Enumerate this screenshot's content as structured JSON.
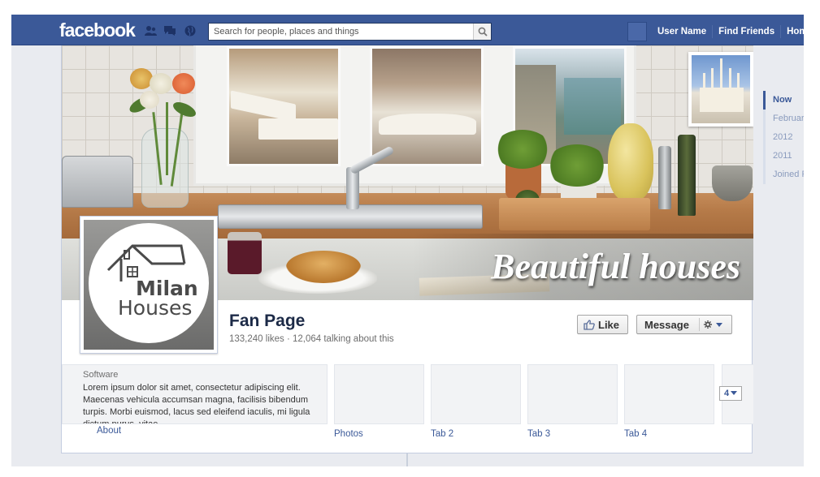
{
  "topbar": {
    "logo": "facebook",
    "search_placeholder": "Search for people, places and things",
    "links": [
      "User Name",
      "Find Friends",
      "Home"
    ]
  },
  "cover": {
    "title": "Beautiful houses"
  },
  "profile": {
    "logo_line1": "Milan",
    "logo_line2": "Houses"
  },
  "page": {
    "name": "Fan Page",
    "stats": "133,240 likes · 12,064 talking about this"
  },
  "actions": {
    "like": "Like",
    "message": "Message"
  },
  "about": {
    "category": "Software",
    "text": "Lorem ipsum dolor sit amet, consectetur adipiscing elit. Maecenas vehicula accumsan magna, facilisis bibendum turpis. Morbi euismod, lacus sed eleifend iaculis, mi ligula dictum purus, vitae",
    "link": "About"
  },
  "tabs": [
    {
      "label": "Photos"
    },
    {
      "label": "Tab 2"
    },
    {
      "label": "Tab 3"
    },
    {
      "label": "Tab 4"
    }
  ],
  "more_tabs": {
    "count": "4"
  },
  "scrubber": [
    "Now",
    "February",
    "2012",
    "2011",
    "Joined Facebook"
  ],
  "colors": {
    "brand": "#3b5998",
    "link": "#3b5998"
  }
}
